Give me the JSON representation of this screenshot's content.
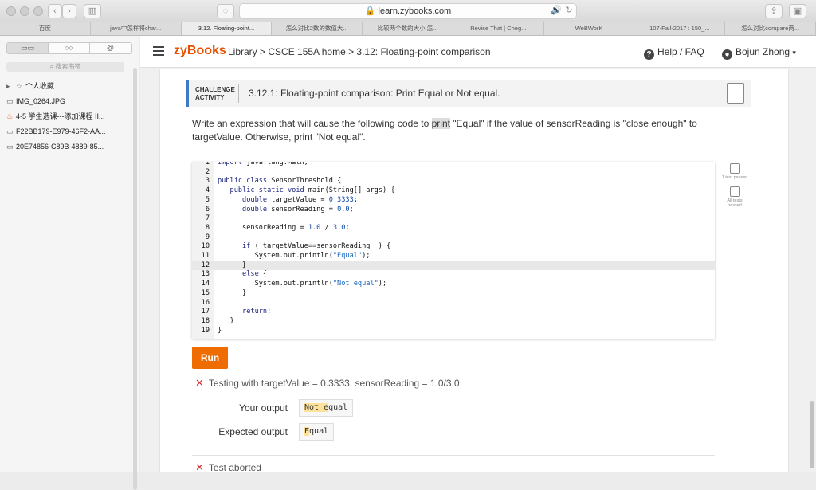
{
  "browser": {
    "url": "learn.zybooks.com",
    "tabs": [
      "百度",
      "java中怎样将char...",
      "3.12. Floating-point...",
      "怎么对比2数的数值大...",
      "比较两个数的大小 怎...",
      "Revise That | Cheg...",
      "WeBWorK",
      "107-Fall-2017 : 150_...",
      "怎么对比compare两..."
    ]
  },
  "sidebar": {
    "search_placeholder": "搜索书签",
    "items": [
      {
        "icon": "☆",
        "label": "个人收藏"
      },
      {
        "icon": "▭",
        "label": "IMG_0264.JPG"
      },
      {
        "icon": "♨",
        "label": "4-5 学生选课---添加课程 II..."
      },
      {
        "icon": "▭",
        "label": "F22BB179-E979-46F2-AA..."
      },
      {
        "icon": "▭",
        "label": "20E74856-C89B-4889-85..."
      }
    ]
  },
  "header": {
    "logo": "zyBooks",
    "breadcrumb": "Library > CSCE 155A home > 3.12: Floating-point comparison",
    "help": "Help / FAQ",
    "user": "Bojun Zhong"
  },
  "activity": {
    "tag_line1": "CHALLENGE",
    "tag_line2": "ACTIVITY",
    "title": "3.12.1: Floating-point comparison: Print Equal or Not equal.",
    "desc_part1": "Write an expression that will cause the following code to ",
    "desc_highlight": "print",
    "desc_part2": " \"Equal\" if the value of sensorReading is \"close enough\" to targetValue. Otherwise, print \"Not equal\"."
  },
  "code_lines": [
    "import java.lang.Math;",
    "",
    "public class SensorThreshold {",
    "   public static void main(String[] args) {",
    "      double targetValue = 0.3333;",
    "      double sensorReading = 0.0;",
    "",
    "      sensorReading = 1.0 / 3.0;",
    "",
    "      if ( targetValue==sensorReading  ) {",
    "         System.out.println(\"Equal\");",
    "      }",
    "      else {",
    "         System.out.println(\"Not equal\");",
    "      }",
    "",
    "      return;",
    "   }",
    "}"
  ],
  "tests": {
    "test1": "1 test passed",
    "test2": "All tests passed"
  },
  "run_label": "Run",
  "results": {
    "testing": "Testing with targetValue = 0.3333, sensorReading = 1.0/3.0",
    "your_output_label": "Your output",
    "your_output_match": "Not e",
    "your_output_rest": "qual",
    "expected_label": "Expected output",
    "expected_first": "E",
    "expected_rest": "qual",
    "aborted": "Test aborted"
  }
}
